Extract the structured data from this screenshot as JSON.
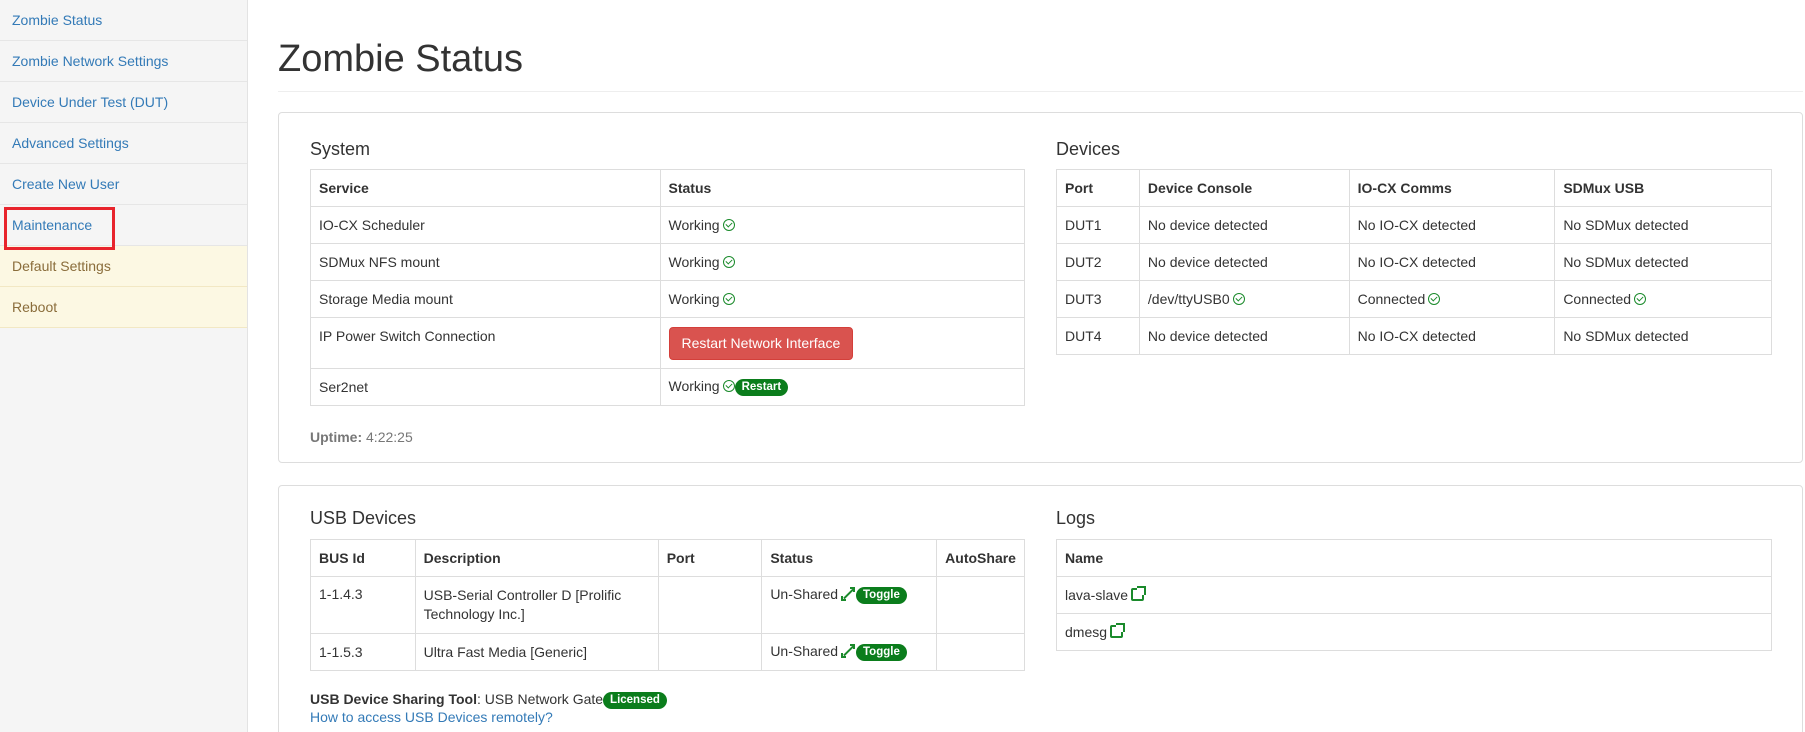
{
  "sidebar": {
    "items": [
      {
        "label": "Zombie Status"
      },
      {
        "label": "Zombie Network Settings"
      },
      {
        "label": "Device Under Test (DUT)"
      },
      {
        "label": "Advanced Settings"
      },
      {
        "label": "Create New User"
      },
      {
        "label": "Maintenance"
      },
      {
        "label": "Default Settings"
      },
      {
        "label": "Reboot"
      }
    ]
  },
  "page": {
    "title": "Zombie Status"
  },
  "system": {
    "heading": "System",
    "headers": {
      "service": "Service",
      "status": "Status"
    },
    "rows": [
      {
        "service": "IO-CX Scheduler",
        "status": "Working"
      },
      {
        "service": "SDMux NFS mount",
        "status": "Working"
      },
      {
        "service": "Storage Media mount",
        "status": "Working"
      },
      {
        "service": "IP Power Switch Connection",
        "button": "Restart Network Interface"
      },
      {
        "service": "Ser2net",
        "status": "Working",
        "badge": "Restart"
      }
    ],
    "uptime_label": "Uptime:",
    "uptime_value": "4:22:25"
  },
  "devices": {
    "heading": "Devices",
    "headers": {
      "port": "Port",
      "console": "Device Console",
      "iocx": "IO-CX Comms",
      "sdmux": "SDMux USB"
    },
    "rows": [
      {
        "port": "DUT1",
        "console": "No device detected",
        "iocx": "No IO-CX detected",
        "sdmux": "No SDMux detected"
      },
      {
        "port": "DUT2",
        "console": "No device detected",
        "iocx": "No IO-CX detected",
        "sdmux": "No SDMux detected"
      },
      {
        "port": "DUT3",
        "console": "/dev/ttyUSB0",
        "iocx": "Connected",
        "sdmux": "Connected"
      },
      {
        "port": "DUT4",
        "console": "No device detected",
        "iocx": "No IO-CX detected",
        "sdmux": "No SDMux detected"
      }
    ]
  },
  "usb": {
    "heading": "USB Devices",
    "headers": {
      "bus": "BUS Id",
      "desc": "Description",
      "port": "Port",
      "status": "Status",
      "autoshare": "AutoShare"
    },
    "rows": [
      {
        "bus": "1-1.4.3",
        "desc": "USB-Serial Controller D [Prolific Technology Inc.]",
        "port": "",
        "status": "Un-Shared",
        "toggle": "Toggle",
        "autoshare": ""
      },
      {
        "bus": "1-1.5.3",
        "desc": "Ultra Fast Media [Generic]",
        "port": "",
        "status": "Un-Shared",
        "toggle": "Toggle",
        "autoshare": ""
      }
    ],
    "tool_label": "USB Device Sharing Tool",
    "tool_value": ": USB Network Gate",
    "tool_badge": "Licensed",
    "help_link": "How to access USB Devices remotely?"
  },
  "logs": {
    "heading": "Logs",
    "header": "Name",
    "rows": [
      {
        "name": "lava-slave"
      },
      {
        "name": "dmesg"
      }
    ]
  },
  "colors": {
    "link": "#337ab7",
    "danger": "#d9534f",
    "success": "#0b7d1c",
    "warning_bg": "#fcf8e3",
    "highlight": "#e8242c"
  }
}
